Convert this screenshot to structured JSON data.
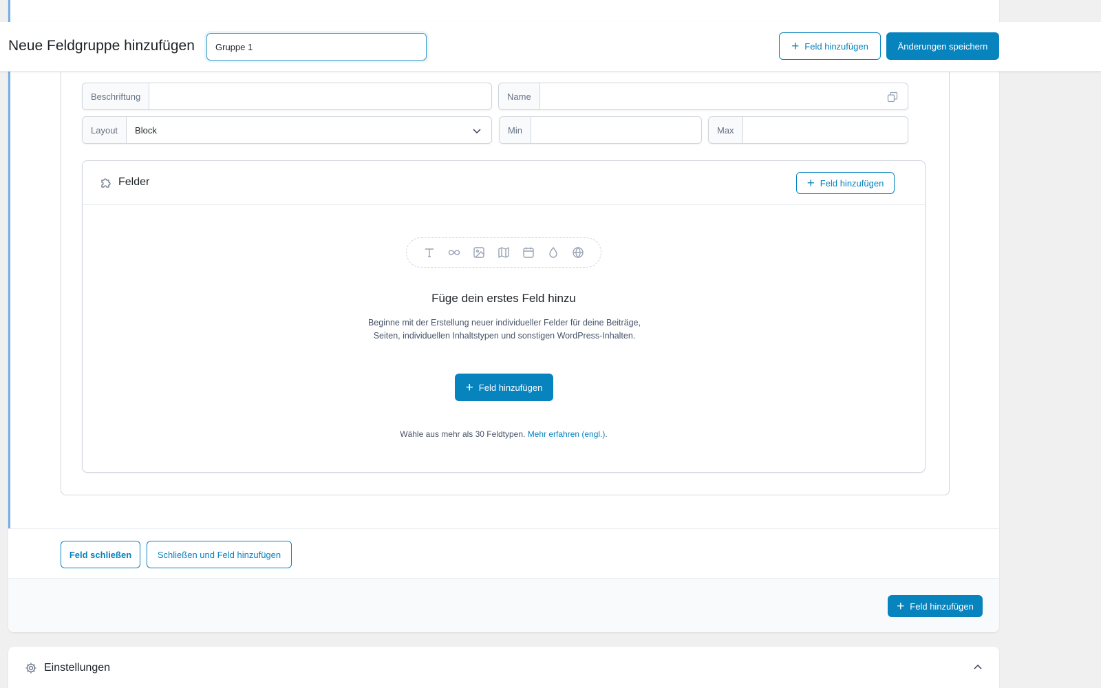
{
  "header": {
    "page_title": "Neue Feldgruppe hinzufügen",
    "group_title_value": "Gruppe 1",
    "add_field_label": "Feld hinzufügen",
    "save_label": "Änderungen speichern"
  },
  "field_settings": {
    "label_caption": "Beschriftung",
    "label_value": "",
    "name_caption": "Name",
    "name_value": "",
    "layout_caption": "Layout",
    "layout_value": "Block",
    "min_caption": "Min",
    "min_value": "",
    "max_caption": "Max",
    "max_value": ""
  },
  "sub_fields": {
    "heading": "Felder",
    "add_field_label": "Feld hinzufügen",
    "field_type_icons": [
      "text-icon",
      "link-icon",
      "image-icon",
      "map-icon",
      "calendar-icon",
      "color-drop-icon",
      "globe-icon"
    ],
    "empty_title": "Füge dein erstes Feld hinzu",
    "empty_description": "Beginne mit der Erstellung neuer individueller Felder für deine Beiträge, Seiten, individuellen Inhaltstypen und sonstigen WordPress-Inhalten.",
    "empty_add_label": "Feld hinzufügen",
    "hint_text": "Wähle aus mehr als 30 Feldtypen.",
    "hint_link": "Mehr erfahren (engl.)",
    "hint_end": "."
  },
  "close_row": {
    "close_label": "Feld schließen",
    "close_add_label": "Schließen und Feld hinzufügen"
  },
  "group_footer": {
    "add_field_label": "Feld hinzufügen"
  },
  "settings": {
    "title": "Einstellungen"
  },
  "colors": {
    "primary": "#0783be",
    "focus_strip": "#72aee6",
    "background": "#f0f0f1"
  }
}
